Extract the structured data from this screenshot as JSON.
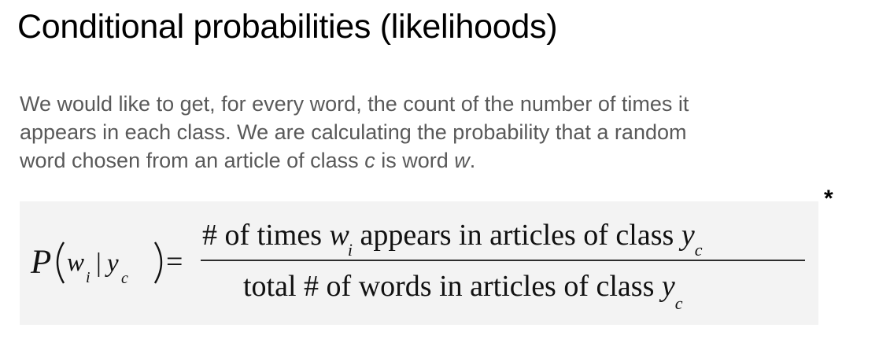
{
  "slide": {
    "title": "Conditional probabilities (likelihoods)",
    "paragraph": {
      "line1": "We would like to get, for every word, the count of the number of times it",
      "line2": "appears in each class. We are calculating the probability that a random",
      "line3_pre": "word chosen from an article of class ",
      "line3_c": "c",
      "line3_mid": " is word ",
      "line3_w": "w",
      "line3_end": "."
    },
    "footnote_marker": "*"
  },
  "formula": {
    "lhs": {
      "P": "P",
      "w": "w",
      "i": "i",
      "bar": "|",
      "y": "y",
      "c": "c",
      "equals": "="
    },
    "numerator": {
      "pre": "# of times ",
      "w": "w",
      "i": "i",
      "post": " appears in articles of class ",
      "y": "y",
      "c": "c"
    },
    "denominator": {
      "pre": "total # of words in articles of class ",
      "y": "y",
      "c": "c"
    }
  }
}
